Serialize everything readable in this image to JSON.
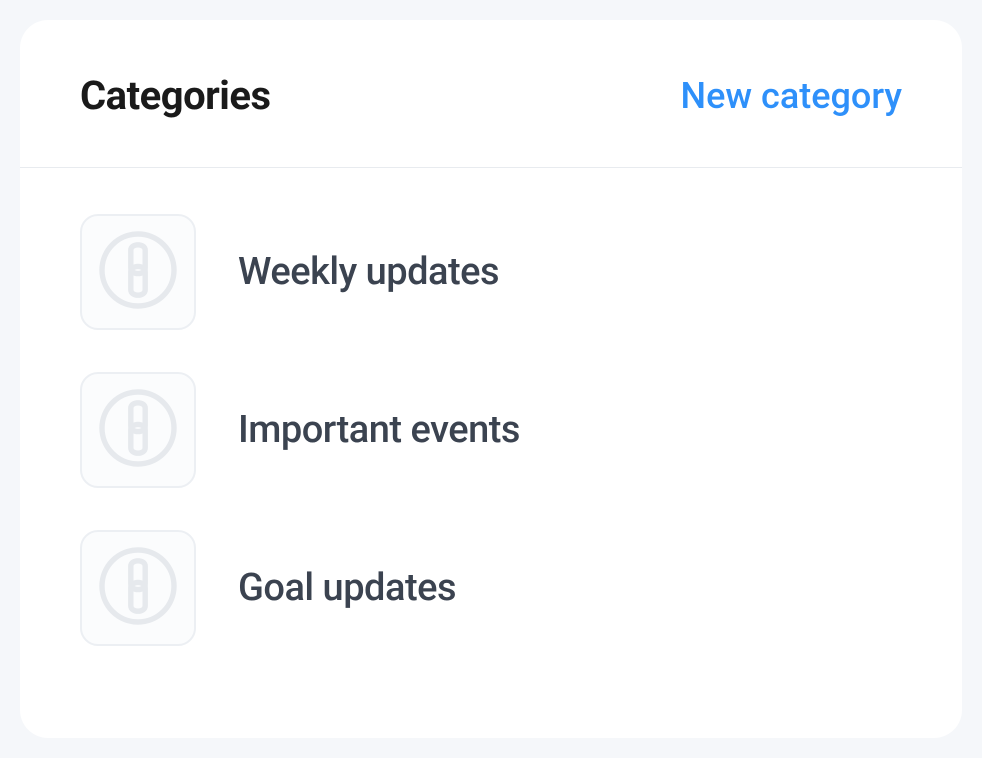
{
  "panel": {
    "title": "Categories",
    "new_category_label": "New category"
  },
  "categories": [
    {
      "label": "Weekly updates",
      "icon": "chain-circle"
    },
    {
      "label": "Important events",
      "icon": "chain-circle"
    },
    {
      "label": "Goal updates",
      "icon": "chain-circle"
    }
  ],
  "colors": {
    "accent": "#2e90fa",
    "text_primary": "#1a1a1a",
    "text_secondary": "#3b4350",
    "page_bg": "#f5f7fa",
    "card_bg": "#ffffff",
    "tile_bg": "#fbfcfd",
    "tile_border": "#eceff3",
    "icon_stroke": "#e6e9ed"
  }
}
